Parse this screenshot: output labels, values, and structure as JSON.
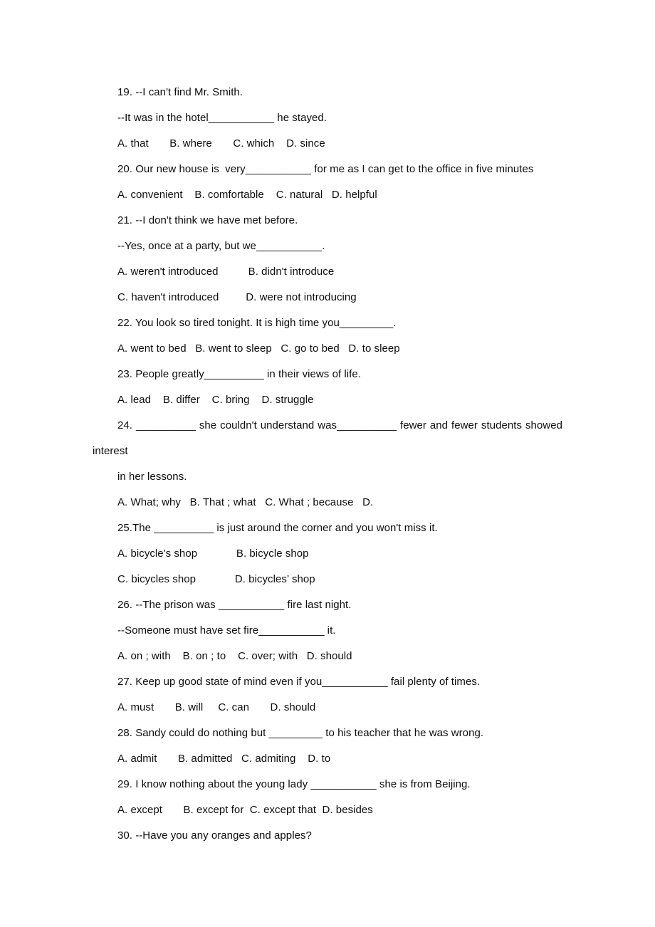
{
  "document": {
    "type": "english-grammar-multiple-choice-exam",
    "lines": [
      {
        "id": "q19-stem",
        "text": "19. --I can't find Mr. Smith.",
        "style": "indent"
      },
      {
        "id": "q19-stem-2",
        "text": "--It was in the hotel___________ he stayed.",
        "style": "indent"
      },
      {
        "id": "q19-options",
        "text": "A. that       B. where       C. which    D. since",
        "style": "indent"
      },
      {
        "id": "q20-stem",
        "text": "20. Our new house is  very___________ for me as I can get to the office in five minutes",
        "style": "indent"
      },
      {
        "id": "q20-options",
        "text": "A. convenient    B. comfortable    C. natural   D. helpful",
        "style": "indent"
      },
      {
        "id": "q21-stem",
        "text": "21. --I don't think we have met before.",
        "style": "indent"
      },
      {
        "id": "q21-stem-2",
        "text": "--Yes, once at a party, but we___________.",
        "style": "indent"
      },
      {
        "id": "q21-options-ab",
        "text": "A. weren't introduced          B. didn't introduce",
        "style": "indent"
      },
      {
        "id": "q21-options-cd",
        "text": "C. haven't introduced         D. were not introducing",
        "style": "indent"
      },
      {
        "id": "q22-stem",
        "text": "22. You look so tired tonight. It is high time you_________.",
        "style": "indent"
      },
      {
        "id": "q22-options",
        "text": "A. went to bed   B. went to sleep   C. go to bed   D. to sleep",
        "style": "indent"
      },
      {
        "id": "q23-stem",
        "text": "23. People greatly__________ in their views of life.",
        "style": "indent"
      },
      {
        "id": "q23-options",
        "text": "A. lead    B. differ    C. bring    D. struggle",
        "style": "indent"
      },
      {
        "id": "q24-stem",
        "text": "24. __________ she couldn't understand was__________ fewer and fewer students showed",
        "style": "justified"
      },
      {
        "id": "q24-stem-wrap",
        "text": "interest",
        "style": "flush"
      },
      {
        "id": "q24-stem-3",
        "text": "in her lessons.",
        "style": "indent"
      },
      {
        "id": "q24-options",
        "text": "A. What; why   B. That ; what   C. What ; because   D.",
        "style": "indent"
      },
      {
        "id": "q25-stem",
        "text": "25.The __________ is just around the corner and you won't miss it.",
        "style": "indent"
      },
      {
        "id": "q25-options-ab",
        "text": "A. bicycle's shop             B. bicycle shop",
        "style": "indent"
      },
      {
        "id": "q25-options-cd",
        "text": "C. bicycles shop             D. bicycles’ shop",
        "style": "indent"
      },
      {
        "id": "q26-stem",
        "text": "26. --The prison was ___________ fire last night.",
        "style": "indent"
      },
      {
        "id": "q26-stem-2",
        "text": "--Someone must have set fire___________ it.",
        "style": "indent"
      },
      {
        "id": "q26-options",
        "text": "A. on ; with    B. on ; to    C. over; with   D. should",
        "style": "indent"
      },
      {
        "id": "q27-stem",
        "text": "27. Keep up good state of mind even if you___________ fail plenty of times.",
        "style": "indent"
      },
      {
        "id": "q27-options",
        "text": "A. must       B. will     C. can       D. should",
        "style": "indent"
      },
      {
        "id": "q28-stem",
        "text": "28. Sandy could do nothing but _________ to his teacher that he was wrong.",
        "style": "indent"
      },
      {
        "id": "q28-options",
        "text": "A. admit       B. admitted   C. admiting    D. to",
        "style": "indent"
      },
      {
        "id": "q29-stem",
        "text": "29. I know nothing about the young lady ___________ she is from Beijing.",
        "style": "indent"
      },
      {
        "id": "q29-options",
        "text": "A. except       B. except for  C. except that  D. besides",
        "style": "indent"
      },
      {
        "id": "q30-stem",
        "text": "30. --Have you any oranges and apples?",
        "style": "indent"
      }
    ]
  },
  "colors": {
    "page_background": "#ffffff",
    "text": "#0d0d0d"
  }
}
